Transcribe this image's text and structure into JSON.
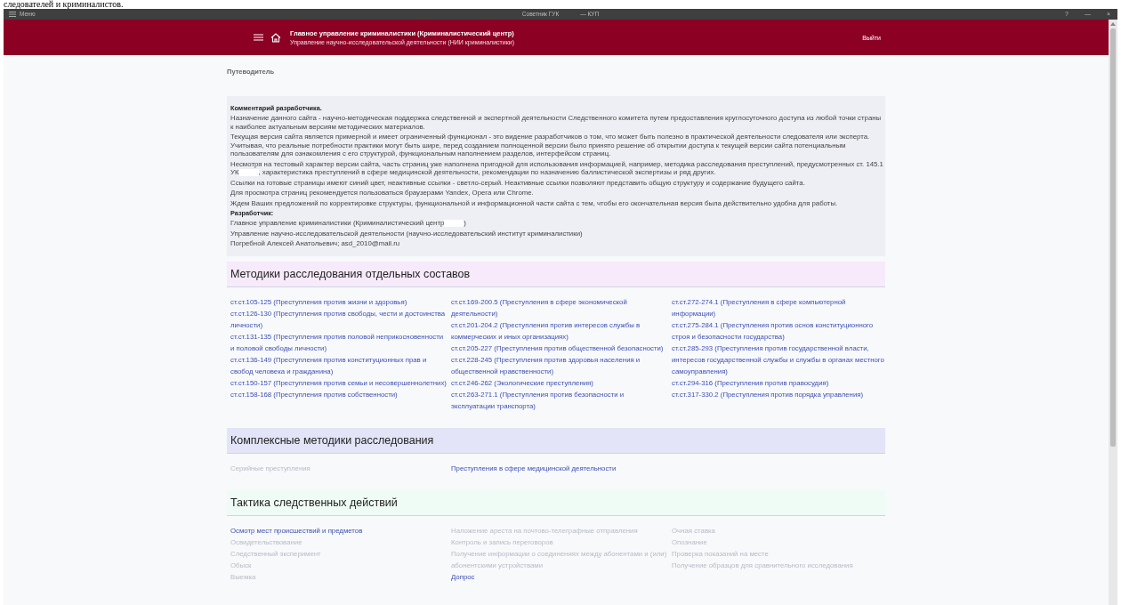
{
  "document_text": "следователей и криминалистов.",
  "window": {
    "menu": "Меню",
    "title": "Советник ГУК",
    "title_suffix": "— КУП",
    "help": "?",
    "minimize": "—",
    "close": "×"
  },
  "header": {
    "title": "Главное управление криминалистики (Криминалистический центр)",
    "subtitle": "Управление научно-исследовательской деятельности (НИИ криминалистики)",
    "logout": "Выйти"
  },
  "breadcrumb": "Путеводитель",
  "comment": {
    "title": "Комментарий разработчика.",
    "paragraphs": [
      {
        "parts": [
          "Назначение данного сайта - научно-методическая поддержка следственной и экспертной деятельности Следственного комитета путем предоставления круглосуточного доступа из любой точки страны к наиболее актуальным версиям методических материалов."
        ]
      },
      {
        "parts": [
          "Текущая версия сайта является примерной и имеет ограниченный функционал - это видение разработчиков о том, что может быть полезно в практической деятельности следователя или эксперта. Учитывая, что реальные потребности практики могут быть шире, перед созданием полноценной версии было принято решение об открытии доступа к текущей версии сайта потенциальным пользователям для ознакомления с его структурой, функциональным наполнением разделов, интерфейсом страниц."
        ]
      },
      {
        "parts": [
          "Несмотря на тестовый характер версии сайта, часть страниц уже наполнена пригодной для использования информацией, например, методика расследования преступлений, предусмотренных ст. 145.1 УК",
          ", характеристика преступлений в сфере медицинской деятельности, рекомендации по назначению баллистической экспертизы и ряд других."
        ]
      },
      {
        "parts": [
          "Ссылки на готовые страницы имеют синий цвет, неактивные ссылки - светло-серый. Неактивные ссылки позволяют представить общую структуру и содержание будущего сайта."
        ]
      },
      {
        "parts": [
          "Для просмотра страниц рекомендуется пользоваться браузерами Yandex, Opera или Chrome."
        ]
      },
      {
        "parts": [
          "Ждем Ваших предложений по корректировке структуры, функциональной и информационной части сайта с тем, чтобы его окончательная версия была действительно удобна для работы."
        ]
      }
    ],
    "developer_label": "Разработчик:",
    "developer_lines": [
      {
        "parts": [
          "Главное управление криминалистики (Криминалистический центр",
          ")"
        ]
      },
      {
        "parts": [
          "Управление научно-исследовательской деятельности (научно-исследовательский институт криминалистики)"
        ]
      },
      {
        "parts": [
          "Погребной Алексей Анатольевич; asd_2010@mail.ru"
        ]
      }
    ]
  },
  "sections": [
    {
      "title": "Методики расследования отдельных составов",
      "color": "#f6eafb",
      "columns": [
        [
          {
            "text": "ст.ст.105-125 (Преступления против жизни и здоровья)",
            "disabled": false
          },
          {
            "text": "ст.ст.126-130 (Преступления против свободы, чести и достоинства личности)",
            "disabled": false
          },
          {
            "text": "ст.ст.131-135 (Преступления против половой неприкосновенности и половой свободы личности)",
            "disabled": false
          },
          {
            "text": "ст.ст.136-149 (Преступления против конституционных прав и свобод человека и гражданина)",
            "disabled": false
          },
          {
            "text": "ст.ст.150-157 (Преступления против семьи и несовершеннолетних)",
            "disabled": false
          },
          {
            "text": "ст.ст.158-168 (Преступления против собственности)",
            "disabled": false
          }
        ],
        [
          {
            "text": "ст.ст.169-200.5 (Преступления в сфере экономической деятельности)",
            "disabled": false
          },
          {
            "text": "ст.ст.201-204.2 (Преступления против интересов службы в коммерческих и иных организациях)",
            "disabled": false
          },
          {
            "text": "ст.ст.205-227 (Преступления против общественной безопасности)",
            "disabled": false
          },
          {
            "text": "ст.ст.228-245 (Преступления против здоровья населения и общественной нравственности)",
            "disabled": false
          },
          {
            "text": "ст.ст.246-262 (Экологические преступления)",
            "disabled": false
          },
          {
            "text": "ст.ст.263-271.1 (Преступления против безопасности и эксплуатации транспорта)",
            "disabled": false
          }
        ],
        [
          {
            "text": "ст.ст.272-274.1 (Преступления в сфере компьютерной информации)",
            "disabled": false
          },
          {
            "text": "ст.ст.275-284.1 (Преступления против основ конституционного строя и безопасности государства)",
            "disabled": false
          },
          {
            "text": "ст.ст.285-293 (Преступления против государственной власти, интересов государственной службы и службы в органах местного самоуправления)",
            "disabled": false
          },
          {
            "text": "ст.ст.294-316 (Преступления против правосудия)",
            "disabled": false
          },
          {
            "text": "ст.ст.317-330.2 (Преступления против порядка управления)",
            "disabled": false
          }
        ]
      ]
    },
    {
      "title": "Комплексные методики расследования",
      "color": "#e3e4f7",
      "columns": [
        [
          {
            "text": "Серийные преступления",
            "disabled": true
          }
        ],
        [
          {
            "text": "Преступления в сфере медицинской деятельности",
            "disabled": false
          }
        ],
        []
      ]
    },
    {
      "title": "Тактика следственных действий",
      "color": "#effbf5",
      "columns": [
        [
          {
            "text": "Осмотр мест происшествий и предметов",
            "disabled": false
          },
          {
            "text": "Освидетельствование",
            "disabled": true
          },
          {
            "text": "Следственный эксперимент",
            "disabled": true
          },
          {
            "text": "Обыск",
            "disabled": true
          },
          {
            "text": "Выемка",
            "disabled": true
          }
        ],
        [
          {
            "text": "Наложение ареста на почтово-телеграфные отправления",
            "disabled": true
          },
          {
            "text": "Контроль и запись переговоров",
            "disabled": true
          },
          {
            "text": "Получение информации о соединениях между абонентами и (или) абонентскими устройствами",
            "disabled": true
          },
          {
            "text": "Допрос",
            "disabled": false
          }
        ],
        [
          {
            "text": "Очная ставка",
            "disabled": true
          },
          {
            "text": "Опознание",
            "disabled": true
          },
          {
            "text": "Проверка показаний на месте",
            "disabled": true
          },
          {
            "text": "Получение образцов для сравнительного исследования",
            "disabled": true
          }
        ]
      ]
    }
  ]
}
